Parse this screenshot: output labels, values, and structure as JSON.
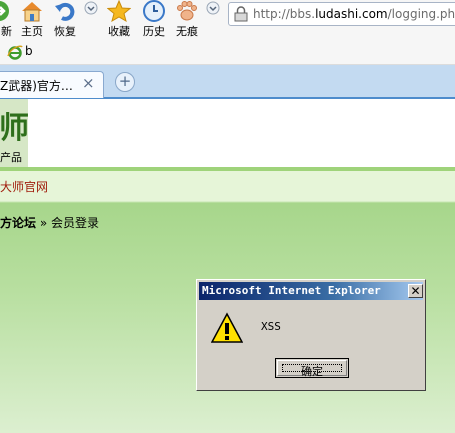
{
  "toolbar": {
    "buttons": [
      {
        "label": "新",
        "icon": "forward-arrow-icon"
      },
      {
        "label": "主页",
        "icon": "home-icon"
      },
      {
        "label": "恢复",
        "icon": "restore-undo-icon"
      },
      {
        "label": "收藏",
        "icon": "star-icon"
      },
      {
        "label": "历史",
        "icon": "clock-icon"
      },
      {
        "label": "无痕",
        "icon": "paw-icon"
      }
    ],
    "address": {
      "prefix": "http://bbs.",
      "domain": "ludashi.com",
      "path": "/logging.php?a"
    }
  },
  "favorites": {
    "item_label": "b",
    "icon": "ie-icon"
  },
  "tabs": {
    "active_title": "Z武器)官方…",
    "close_symbol": "×",
    "new_tab_symbol": "+"
  },
  "page": {
    "logo_glyph": "师",
    "logo_text": "产品",
    "site_link": "大师官网",
    "breadcrumb": {
      "forum": "方论坛",
      "sep": " » ",
      "current": "会员登录"
    }
  },
  "dialog": {
    "title": "Microsoft Internet Explorer",
    "message": "XSS",
    "ok_label": "确定",
    "close_symbol": "✕"
  },
  "colors": {
    "tab_strip": "#c3daf1",
    "page_green": "#a7d68b",
    "dialog_title": "#0a246a",
    "link_red": "#a01c0c"
  }
}
